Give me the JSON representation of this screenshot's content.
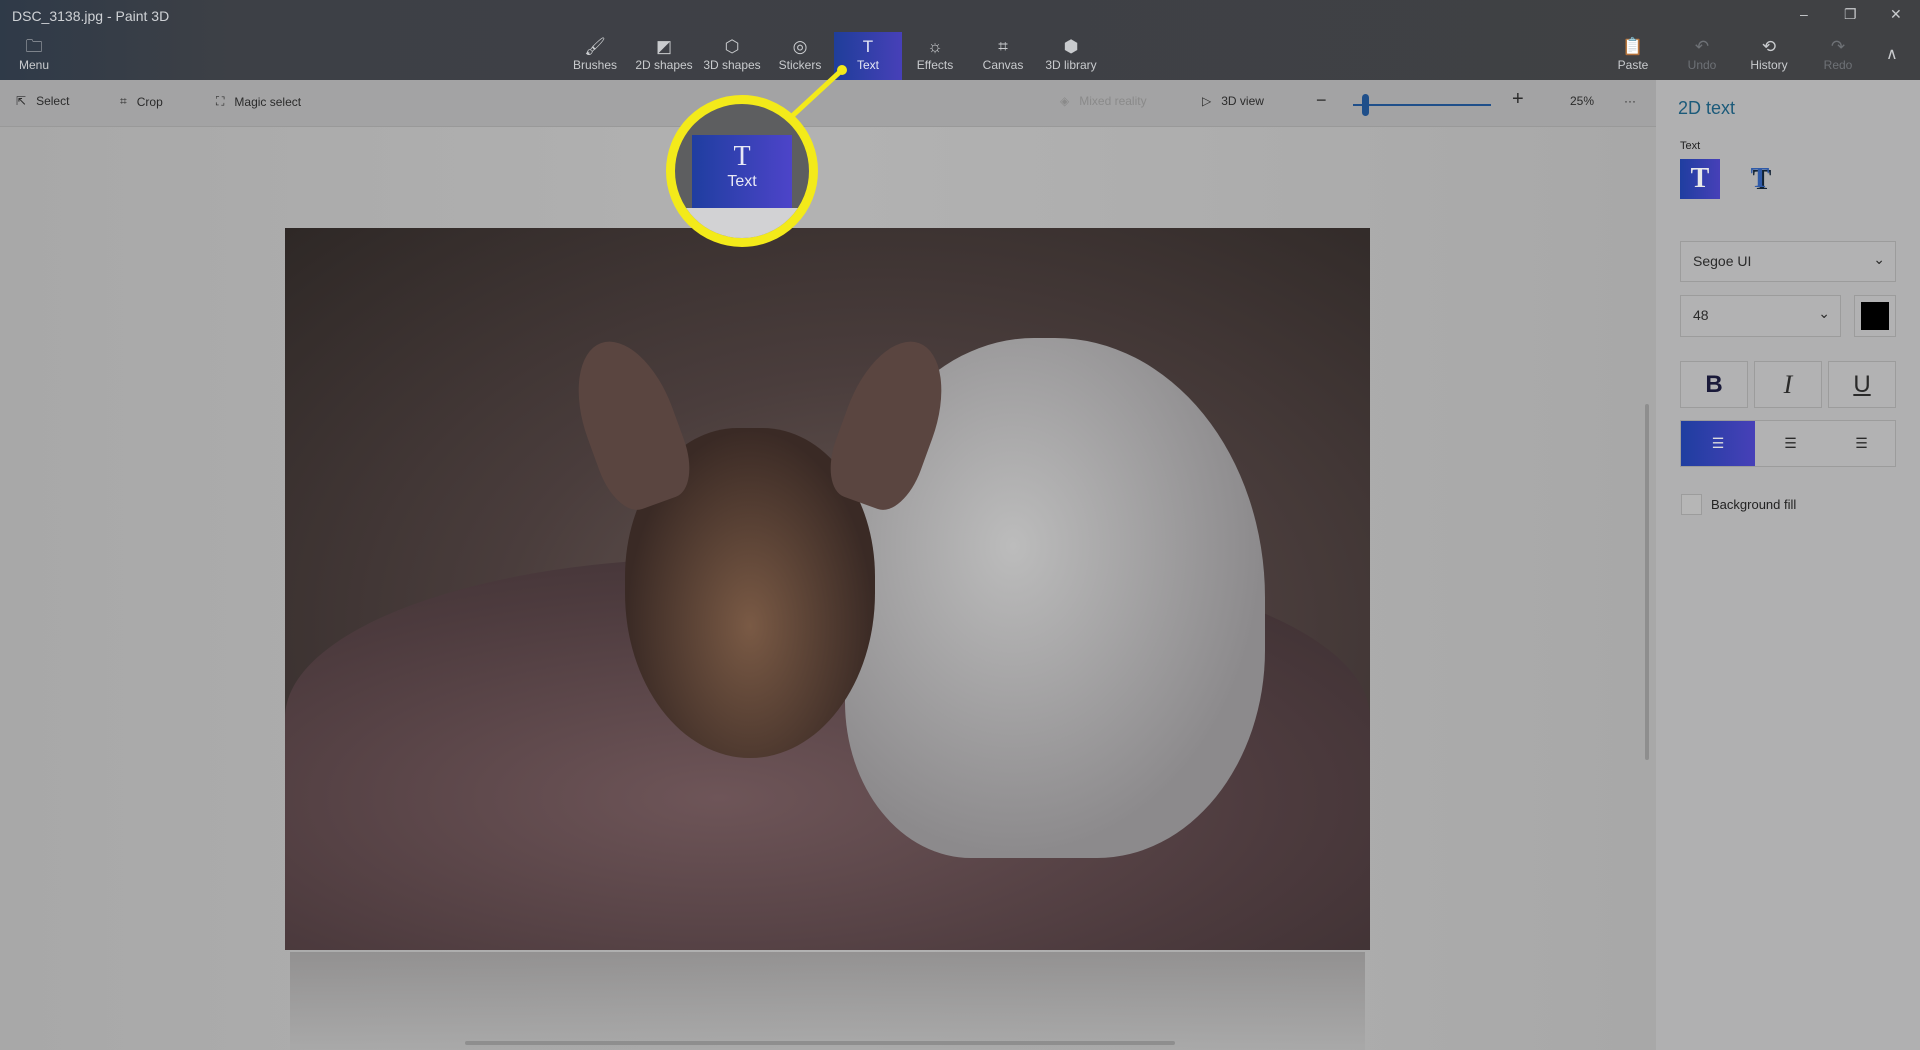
{
  "window": {
    "title": "DSC_3138.jpg - Paint 3D",
    "controls": [
      "minimize",
      "restore",
      "close"
    ]
  },
  "menu": {
    "label": "Menu",
    "icon": "folder-icon"
  },
  "tabs": [
    {
      "label": "Brushes",
      "icon": "brush-icon"
    },
    {
      "label": "2D shapes",
      "icon": "2d-shapes-icon"
    },
    {
      "label": "3D shapes",
      "icon": "3d-shapes-icon"
    },
    {
      "label": "Stickers",
      "icon": "sticker-icon"
    },
    {
      "label": "Text",
      "icon": "text-icon",
      "active": true
    },
    {
      "label": "Effects",
      "icon": "effects-icon"
    },
    {
      "label": "Canvas",
      "icon": "canvas-icon"
    },
    {
      "label": "3D library",
      "icon": "3d-library-icon"
    }
  ],
  "actions": [
    {
      "label": "Paste",
      "icon": "paste-icon"
    },
    {
      "label": "Undo",
      "icon": "undo-icon",
      "disabled": true
    },
    {
      "label": "History",
      "icon": "history-icon"
    },
    {
      "label": "Redo",
      "icon": "redo-icon",
      "disabled": true
    }
  ],
  "toolbar": {
    "select": "Select",
    "crop": "Crop",
    "magic_select": "Magic select",
    "mixed_reality": "Mixed reality",
    "view3d": "3D view",
    "zoom": "25%",
    "zoom_value": 25,
    "more": "···"
  },
  "callout": {
    "label": "Text"
  },
  "panel": {
    "title": "2D text",
    "section": "Text",
    "font": "Segoe UI",
    "size": "48",
    "color": "#000000",
    "bold": "B",
    "italic": "I",
    "underline": "U",
    "alignment": "left",
    "background_fill": "Background fill",
    "background_fill_checked": false
  },
  "colors": {
    "accent": "#2b3fa8",
    "highlight": "#f3ea1a",
    "title_accent": "#1b5a7a"
  }
}
